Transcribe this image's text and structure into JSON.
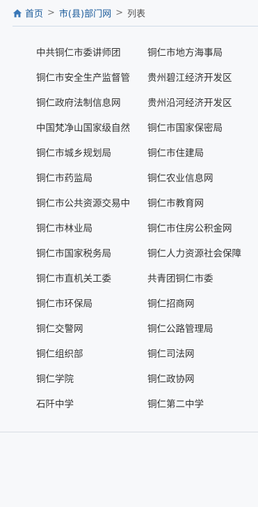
{
  "breadcrumb": {
    "home_label": "首页",
    "sep": ">",
    "section_label": "市(县)部门网",
    "current_label": "列表"
  },
  "links": [
    "中共铜仁市委讲师团",
    "铜仁市地方海事局",
    "铜仁市安全生产监督管",
    "贵州碧江经济开发区",
    "铜仁政府法制信息网",
    "贵州沿河经济开发区",
    "中国梵净山国家级自然",
    "铜仁市国家保密局",
    "铜仁市城乡规划局",
    "铜仁市住建局",
    "铜仁市药监局",
    "铜仁农业信息网",
    "铜仁市公共资源交易中",
    "铜仁市教育网",
    "铜仁市林业局",
    "铜仁市住房公积金网",
    "铜仁市国家税务局",
    "铜仁人力资源社会保障",
    "铜仁市直机关工委",
    "共青团铜仁市委",
    "铜仁市环保局",
    "铜仁招商网",
    "铜仁交警网",
    "铜仁公路管理局",
    "铜仁组织部",
    "铜仁司法网",
    "铜仁学院",
    "铜仁政协网",
    "石阡中学",
    "铜仁第二中学"
  ],
  "colors": {
    "link_blue": "#1a5a9a",
    "text": "#333333",
    "background": "#f7f8fa"
  }
}
